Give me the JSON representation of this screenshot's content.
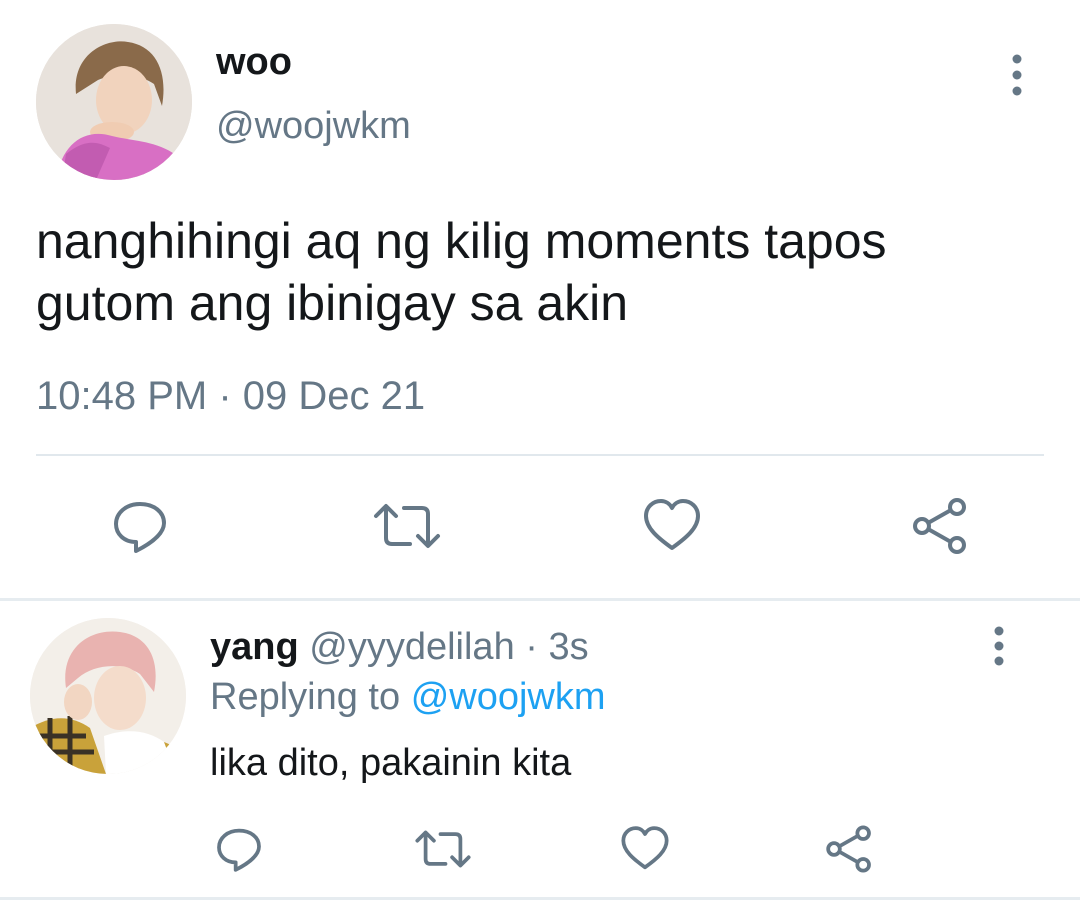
{
  "colors": {
    "text": "#14171a",
    "secondary": "#657786",
    "accent": "#1da1f2",
    "divider": "#e1e8ed",
    "icon": "#657786"
  },
  "tweet": {
    "author_name": "woo",
    "author_handle": "@woojwkm",
    "text": "nanghihingi aq ng kilig moments tapos gutom ang ibinigay sa akin",
    "timestamp": "10:48 PM · 09 Dec 21",
    "more_icon": "more-vertical-icon",
    "actions": [
      "reply-icon",
      "retweet-icon",
      "like-icon",
      "share-icon"
    ]
  },
  "reply": {
    "author_name": "yang",
    "author_handle": "@yyydelilah",
    "separator": "·",
    "time": "3s",
    "replying_label": "Replying to",
    "replying_to": "@woojwkm",
    "text": "lika dito, pakainin kita",
    "more_icon": "more-vertical-icon",
    "actions": [
      "reply-icon",
      "retweet-icon",
      "like-icon",
      "share-icon"
    ]
  }
}
